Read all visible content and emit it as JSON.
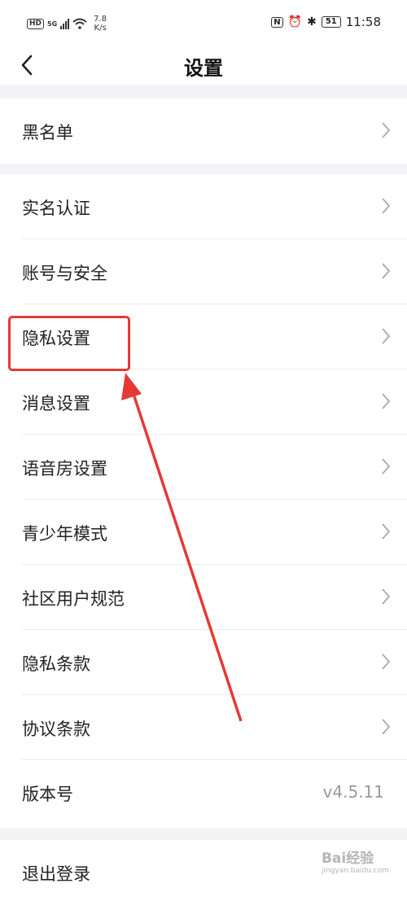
{
  "status_bar": {
    "hd": "HD",
    "network": "5G",
    "speed_value": "7.8",
    "speed_unit": "K/s",
    "battery": "51",
    "time": "11:58",
    "nfc_glyph": "N",
    "alarm_glyph": "⏰",
    "bluetooth_glyph": "✱"
  },
  "header": {
    "title": "设置",
    "back_icon": "chevron-left-icon"
  },
  "settings": {
    "blacklist": "黑名单",
    "items": [
      {
        "label": "实名认证"
      },
      {
        "label": "账号与安全"
      },
      {
        "label": "隐私设置"
      },
      {
        "label": "消息设置"
      },
      {
        "label": "语音房设置"
      },
      {
        "label": "青少年模式"
      },
      {
        "label": "社区用户规范"
      },
      {
        "label": "隐私条款"
      },
      {
        "label": "协议条款"
      }
    ],
    "version_label": "版本号",
    "version_value": "v4.5.11",
    "logout": "退出登录"
  },
  "annotation": {
    "color": "#e53935"
  },
  "watermark": {
    "text": "Bai经验",
    "sub": "jingyan.baidu.com"
  }
}
